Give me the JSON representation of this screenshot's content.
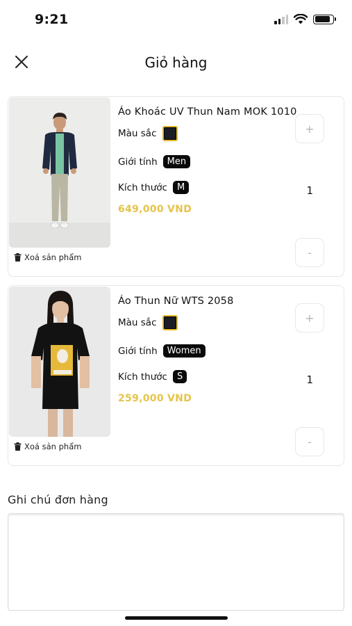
{
  "status_bar": {
    "time": "9:21"
  },
  "header": {
    "title": "Giỏ hàng",
    "close_icon": "close-icon"
  },
  "cart": {
    "items": [
      {
        "name": "Áo Khoác UV Thun Nam MOK 1010",
        "color_label": "Màu sắc",
        "color_value": "#1c1c24",
        "gender_label": "Giới tính",
        "gender_value": "Men",
        "size_label": "Kích thước",
        "size_value": "M",
        "price": "649,000 VND",
        "quantity": "1",
        "plus_label": "+",
        "minus_label": "-",
        "delete_label": "Xoá sản phẩm"
      },
      {
        "name": "Áo Thun Nữ WTS 2058",
        "color_label": "Màu sắc",
        "color_value": "#1c1c24",
        "gender_label": "Giới tính",
        "gender_value": "Women",
        "size_label": "Kích thước",
        "size_value": "S",
        "price": "259,000 VND",
        "quantity": "1",
        "plus_label": "+",
        "minus_label": "-",
        "delete_label": "Xoá sản phẩm"
      }
    ]
  },
  "note": {
    "label": "Ghi chú đơn hàng",
    "value": ""
  },
  "colors": {
    "price": "#e5c44a",
    "accent_border": "#e2b92b",
    "tag_bg": "#0a0a0a"
  }
}
